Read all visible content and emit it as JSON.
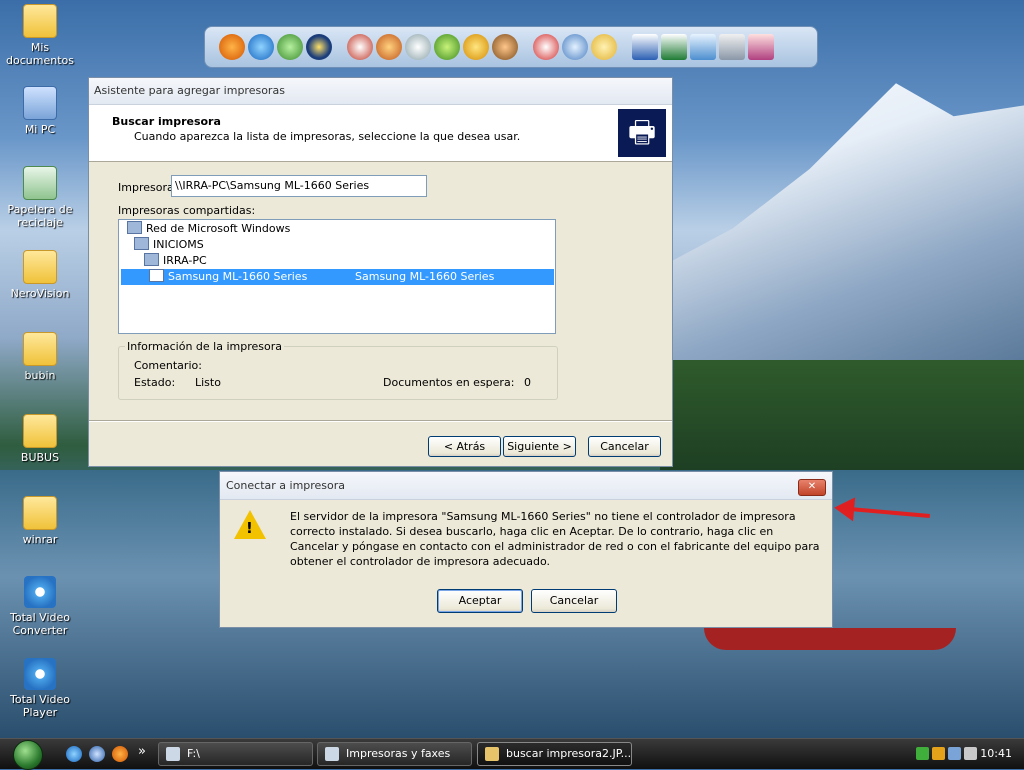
{
  "desktop": {
    "icons": [
      {
        "label": "Mis documentos",
        "icon": "folder-icon"
      },
      {
        "label": "Mi PC",
        "icon": "computer-icon"
      },
      {
        "label": "Papelera de reciclaje",
        "icon": "recycle-bin-icon"
      },
      {
        "label": "NeroVision",
        "icon": "folder-icon"
      },
      {
        "label": "bubin",
        "icon": "folder-icon"
      },
      {
        "label": "BUBUS",
        "icon": "folder-icon"
      },
      {
        "label": "winrar",
        "icon": "folder-icon"
      },
      {
        "label": "Total Video Converter",
        "icon": "video-converter-icon"
      },
      {
        "label": "Total Video Player",
        "icon": "video-player-icon"
      }
    ]
  },
  "dock": {
    "icons": [
      "firefox-icon",
      "ie-icon",
      "messenger-icon",
      "media-player-icon",
      "poker-icon",
      "p-app-icon",
      "pinwheel-icon",
      "green-app-icon",
      "duck-icon",
      "game-icon",
      "fire-icon",
      "network-icon",
      "folder-icon",
      "word-icon",
      "excel-icon",
      "notes-icon",
      "calculator-icon",
      "paint-icon"
    ]
  },
  "wizard": {
    "title": "Asistente para agregar impresoras",
    "header_title": "Buscar impresora",
    "header_subtitle": "Cuando aparezca la lista de impresoras, seleccione la que desea usar.",
    "printer_label": "Impresora:",
    "printer_value": "\\\\IRRA-PC\\Samsung ML-1660 Series",
    "shared_label": "Impresoras compartidas:",
    "tree": [
      {
        "label": "Red de Microsoft Windows"
      },
      {
        "label": "INICIOMS"
      },
      {
        "label": "IRRA-PC"
      },
      {
        "label": "Samsung ML-1660 Series",
        "comment": "Samsung ML-1660 Series",
        "selected": true
      }
    ],
    "info_title": "Información de la impresora",
    "comment_label": "Comentario:",
    "status_label": "Estado:",
    "status_value": "Listo",
    "queue_label": "Documentos en espera:",
    "queue_value": "0",
    "back_button": "< Atrás",
    "next_button": "Siguiente >",
    "cancel_button": "Cancelar"
  },
  "dialog": {
    "title": "Conectar a impresora",
    "close_glyph": "✕",
    "message": "El servidor de la impresora \"Samsung ML-1660 Series\" no tiene el controlador de impresora correcto instalado. Si desea buscarlo, haga clic en Aceptar. De lo contrario, haga clic en Cancelar y póngase en contacto con el administrador de red o con el fabricante del equipo para obtener el controlador de impresora adecuado.",
    "warning_glyph": "!",
    "ok_button": "Aceptar",
    "cancel_button": "Cancelar"
  },
  "taskbar": {
    "more_glyph": "»",
    "tasks": [
      {
        "label": "F:\\"
      },
      {
        "label": "Impresoras y faxes"
      },
      {
        "label": "buscar impresora2.JP...",
        "active": true
      }
    ],
    "clock": "10:41"
  }
}
